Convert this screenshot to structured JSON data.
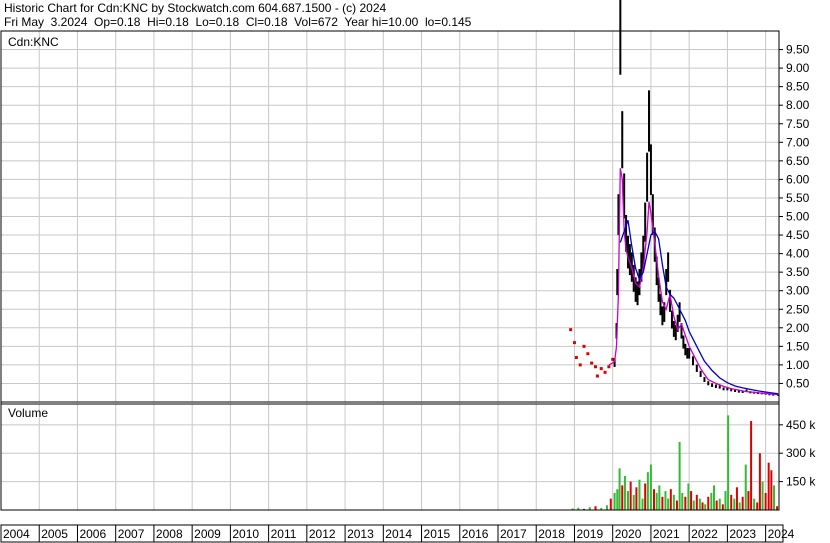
{
  "header": {
    "line1": "Historic Chart for Cdn:KNC by Stockwatch.com 604.687.1500 - (c) 2024",
    "line2": "Fri May  3.2024  Op=0.18  Hi=0.18  Lo=0.18  Cl=0.18  Vol=672  Year hi=10.00  lo=0.145"
  },
  "colors": {
    "price_bar": "#000000",
    "down_dot": "#dd0000",
    "ma_short": "#cc00cc",
    "ma_long": "#0000cc",
    "vol_up": "#33bb33",
    "vol_down": "#dd0000",
    "grid": "#c8c8c8"
  },
  "chart_data": [
    {
      "type": "line",
      "title": "Cdn:KNC",
      "y_ticks": [
        "9.50",
        "9.00",
        "8.50",
        "8.00",
        "7.50",
        "7.00",
        "6.50",
        "6.00",
        "5.50",
        "5.00",
        "4.50",
        "4.00",
        "3.50",
        "3.00",
        "2.50",
        "2.00",
        "1.50",
        "1.00",
        "0.50"
      ],
      "ylim": [
        0,
        10
      ],
      "x_ticks": [
        "2004",
        "2005",
        "2006",
        "2007",
        "2008",
        "2009",
        "2010",
        "2011",
        "2012",
        "2013",
        "2014",
        "2015",
        "2016",
        "2017",
        "2018",
        "2019",
        "2020",
        "2021",
        "2022",
        "2023",
        "2024"
      ],
      "xlim": [
        2004,
        2024.35
      ],
      "grid": true,
      "series": [
        {
          "style": "price",
          "x": [
            2018.9,
            2019.0,
            2019.05,
            2019.15,
            2019.25,
            2019.35,
            2019.45,
            2019.55,
            2019.6,
            2019.7,
            2019.8,
            2019.9,
            2020.0,
            2020.05,
            2020.1,
            2020.12,
            2020.15,
            2020.2,
            2020.25,
            2020.3,
            2020.35,
            2020.4,
            2020.45,
            2020.5,
            2020.55,
            2020.6,
            2020.65,
            2020.7,
            2020.75,
            2020.8,
            2020.85,
            2020.9,
            2020.95,
            2021.0,
            2021.05,
            2021.1,
            2021.15,
            2021.2,
            2021.25,
            2021.3,
            2021.35,
            2021.4,
            2021.45,
            2021.5,
            2021.55,
            2021.6,
            2021.65,
            2021.7,
            2021.75,
            2021.8,
            2021.85,
            2021.9,
            2021.95,
            2022.0,
            2022.1,
            2022.2,
            2022.3,
            2022.4,
            2022.5,
            2022.6,
            2022.7,
            2022.8,
            2022.9,
            2023.0,
            2023.1,
            2023.2,
            2023.3,
            2023.4,
            2023.5,
            2023.6,
            2023.7,
            2023.8,
            2023.9,
            2024.0,
            2024.1,
            2024.2,
            2024.33
          ],
          "y": [
            1.95,
            1.6,
            1.2,
            1.0,
            1.5,
            1.3,
            1.05,
            0.95,
            0.7,
            0.9,
            0.8,
            0.95,
            1.15,
            1.05,
            1.9,
            3.2,
            5.0,
            9.8,
            7.0,
            5.5,
            4.5,
            4.0,
            3.8,
            3.6,
            3.3,
            3.0,
            2.9,
            3.2,
            3.6,
            4.0,
            4.8,
            6.0,
            7.5,
            6.2,
            5.0,
            4.2,
            3.5,
            3.0,
            2.6,
            2.3,
            2.4,
            3.2,
            3.6,
            2.7,
            2.2,
            1.95,
            1.85,
            2.1,
            2.4,
            1.9,
            1.6,
            1.4,
            1.3,
            1.3,
            1.1,
            0.9,
            0.75,
            0.6,
            0.5,
            0.45,
            0.42,
            0.4,
            0.35,
            0.35,
            0.32,
            0.3,
            0.28,
            0.27,
            0.3,
            0.26,
            0.25,
            0.24,
            0.23,
            0.22,
            0.2,
            0.19,
            0.18
          ]
        },
        {
          "name": "",
          "style": "ma_short",
          "x": [
            2019.9,
            2020.0,
            2020.05,
            2020.1,
            2020.15,
            2020.2,
            2020.25,
            2020.3,
            2020.35,
            2020.4,
            2020.5,
            2020.6,
            2020.7,
            2020.8,
            2020.9,
            2020.95,
            2021.0,
            2021.1,
            2021.2,
            2021.3,
            2021.4,
            2021.5,
            2021.6,
            2021.7,
            2021.8,
            2021.9,
            2022.0,
            2022.1,
            2022.2,
            2022.3,
            2022.4,
            2022.5,
            2022.7,
            2022.9,
            2023.1,
            2023.3,
            2023.5,
            2023.7,
            2023.9,
            2024.1,
            2024.33
          ],
          "y": [
            1.0,
            1.05,
            1.1,
            1.5,
            2.9,
            6.3,
            6.0,
            4.6,
            4.1,
            3.9,
            3.6,
            3.2,
            3.1,
            3.6,
            4.6,
            5.4,
            5.1,
            4.3,
            3.4,
            2.7,
            2.5,
            2.9,
            2.3,
            1.95,
            2.1,
            1.8,
            1.5,
            1.3,
            1.1,
            0.9,
            0.75,
            0.6,
            0.5,
            0.42,
            0.36,
            0.32,
            0.28,
            0.26,
            0.24,
            0.22,
            0.2
          ]
        },
        {
          "name": "",
          "style": "ma_long",
          "x": [
            2020.2,
            2020.3,
            2020.4,
            2020.5,
            2020.6,
            2020.7,
            2020.8,
            2020.9,
            2021.0,
            2021.1,
            2021.2,
            2021.3,
            2021.4,
            2021.5,
            2021.6,
            2021.7,
            2021.8,
            2021.9,
            2022.0,
            2022.2,
            2022.4,
            2022.6,
            2022.8,
            2023.0,
            2023.2,
            2023.4,
            2023.6,
            2023.8,
            2024.0,
            2024.2,
            2024.33
          ],
          "y": [
            4.3,
            4.6,
            4.9,
            4.2,
            3.6,
            3.3,
            3.5,
            4.0,
            4.5,
            4.6,
            4.4,
            3.7,
            3.1,
            2.9,
            2.8,
            2.6,
            2.4,
            2.2,
            1.9,
            1.5,
            1.1,
            0.85,
            0.65,
            0.52,
            0.43,
            0.38,
            0.34,
            0.3,
            0.27,
            0.24,
            0.22
          ]
        }
      ]
    },
    {
      "type": "bar",
      "title": "Volume",
      "y_ticks": [
        "450 k",
        "300 k",
        "150 k"
      ],
      "ylim": [
        0,
        560000
      ],
      "x": [
        2018.95,
        2019.1,
        2019.25,
        2019.4,
        2019.55,
        2019.7,
        2019.85,
        2019.95,
        2020.05,
        2020.12,
        2020.18,
        2020.25,
        2020.32,
        2020.4,
        2020.47,
        2020.55,
        2020.62,
        2020.7,
        2020.78,
        2020.85,
        2020.92,
        2021.0,
        2021.08,
        2021.15,
        2021.22,
        2021.3,
        2021.38,
        2021.45,
        2021.52,
        2021.6,
        2021.68,
        2021.75,
        2021.82,
        2021.9,
        2021.98,
        2022.05,
        2022.12,
        2022.2,
        2022.28,
        2022.35,
        2022.42,
        2022.5,
        2022.58,
        2022.65,
        2022.72,
        2022.8,
        2022.88,
        2022.95,
        2023.02,
        2023.1,
        2023.18,
        2023.25,
        2023.32,
        2023.4,
        2023.48,
        2023.55,
        2023.62,
        2023.7,
        2023.78,
        2023.85,
        2023.92,
        2024.0,
        2024.08,
        2024.15,
        2024.22,
        2024.3
      ],
      "values": [
        8000,
        12000,
        6000,
        15000,
        20000,
        10000,
        25000,
        60000,
        90000,
        110000,
        220000,
        130000,
        180000,
        100000,
        150000,
        80000,
        120000,
        160000,
        60000,
        140000,
        200000,
        240000,
        110000,
        90000,
        130000,
        70000,
        100000,
        60000,
        110000,
        80000,
        50000,
        360000,
        90000,
        70000,
        140000,
        100000,
        50000,
        80000,
        60000,
        40000,
        30000,
        70000,
        90000,
        130000,
        50000,
        60000,
        30000,
        100000,
        500000,
        80000,
        60000,
        120000,
        40000,
        70000,
        240000,
        100000,
        470000,
        60000,
        40000,
        300000,
        150000,
        90000,
        250000,
        210000,
        130000,
        20000
      ],
      "up": [
        true,
        true,
        false,
        true,
        false,
        true,
        true,
        false,
        true,
        true,
        true,
        false,
        true,
        true,
        false,
        true,
        false,
        true,
        true,
        false,
        true,
        true,
        false,
        true,
        true,
        false,
        true,
        true,
        false,
        true,
        false,
        true,
        true,
        false,
        true,
        false,
        true,
        false,
        true,
        false,
        true,
        false,
        true,
        true,
        false,
        true,
        false,
        true,
        true,
        false,
        true,
        false,
        true,
        false,
        true,
        false,
        false,
        true,
        false,
        false,
        true,
        false,
        false,
        false,
        true,
        false
      ]
    }
  ]
}
